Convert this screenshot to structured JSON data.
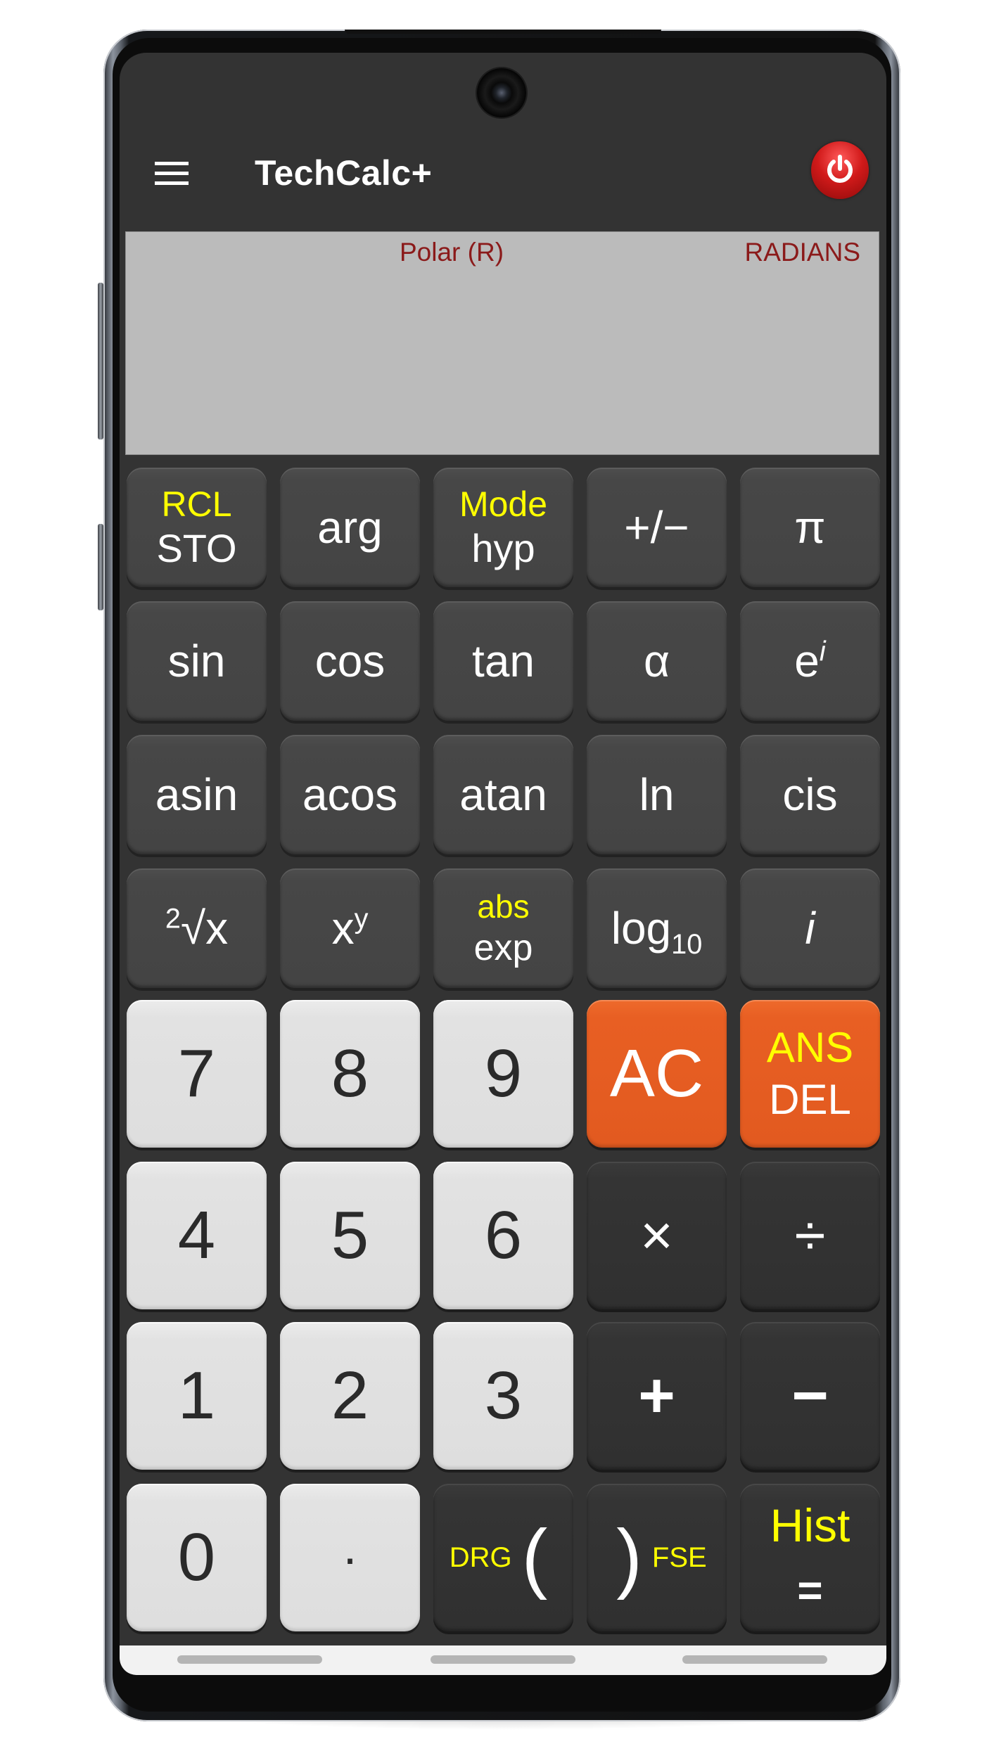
{
  "app": {
    "title": "TechCalc+",
    "menu_icon": "hamburger-menu-icon",
    "power_icon": "power-icon"
  },
  "display": {
    "mode_label": "Polar (R)",
    "angle_label": "RADIANS",
    "expression": "",
    "result": ""
  },
  "keys": {
    "sto": {
      "secondary": "RCL",
      "primary": "STO"
    },
    "arg": {
      "primary": "arg"
    },
    "hyp": {
      "secondary": "Mode",
      "primary": "hyp"
    },
    "negate": {
      "primary": "+/−"
    },
    "pi": {
      "primary": "π"
    },
    "sin": {
      "primary": "sin"
    },
    "cos": {
      "primary": "cos"
    },
    "tan": {
      "primary": "tan"
    },
    "alpha": {
      "primary": "α"
    },
    "exp_i": {
      "base": "e",
      "sup": "i"
    },
    "asin": {
      "primary": "asin"
    },
    "acos": {
      "primary": "acos"
    },
    "atan": {
      "primary": "atan"
    },
    "ln": {
      "primary": "ln"
    },
    "cis": {
      "primary": "cis"
    },
    "root": {
      "sup": "2",
      "base": "√x"
    },
    "power": {
      "base": "x",
      "sup": "y"
    },
    "exp": {
      "secondary": "abs",
      "primary": "exp"
    },
    "log10": {
      "base": "log",
      "sub": "10"
    },
    "imag": {
      "primary": "i"
    },
    "d7": "7",
    "d8": "8",
    "d9": "9",
    "ac": {
      "primary": "AC"
    },
    "del": {
      "secondary": "ANS",
      "primary": "DEL"
    },
    "d4": "4",
    "d5": "5",
    "d6": "6",
    "multiply": "×",
    "divide": "÷",
    "d1": "1",
    "d2": "2",
    "d3": "3",
    "plus": "+",
    "minus": "−",
    "d0": "0",
    "dot": "·",
    "open_paren": {
      "secondary": "DRG",
      "primary": "("
    },
    "close_paren": {
      "primary": ")",
      "secondary": "FSE"
    },
    "equals": {
      "secondary": "Hist",
      "primary": "="
    }
  },
  "colors": {
    "app_bar": "#333333",
    "display_bg": "#bbbbbb",
    "display_text": "#8b1a1a",
    "secondary_label": "#ffff00",
    "orange_key": "#e85f23",
    "function_key": "#474747",
    "operator_key": "#333333",
    "number_key": "#e0e0e0",
    "power_button": "#d11a1a"
  }
}
